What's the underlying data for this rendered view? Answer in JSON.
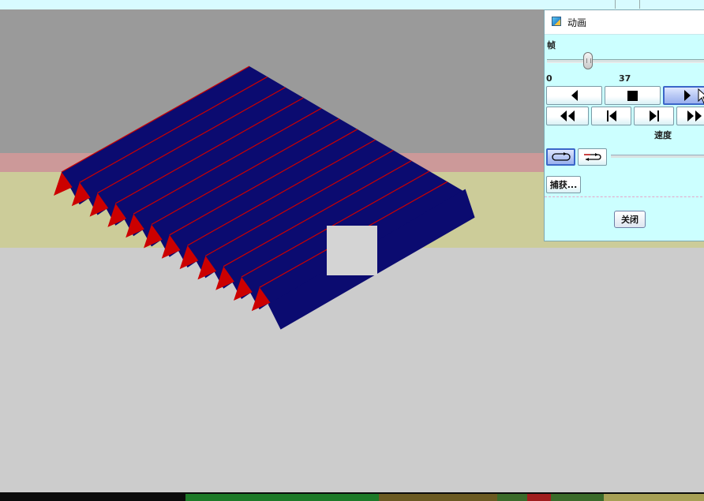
{
  "window": {
    "title": "动画"
  },
  "panel": {
    "frame_label": "帧",
    "slider_min_label": "0",
    "slider_value_label": "37",
    "slider_value": 37,
    "speed_label": "速度",
    "capture_label": "捕获...",
    "close_label": "关闭"
  },
  "controls": [
    {
      "id": "step-back",
      "icon": "triangle-left-icon"
    },
    {
      "id": "stop",
      "icon": "stop-square-icon"
    },
    {
      "id": "play",
      "icon": "triangle-right-icon",
      "active": true
    },
    {
      "id": "fast-back",
      "icon": "double-triangle-left-icon"
    },
    {
      "id": "to-start",
      "icon": "skip-to-start-icon"
    },
    {
      "id": "to-end",
      "icon": "skip-to-end-icon"
    },
    {
      "id": "fast-forward",
      "icon": "double-triangle-right-icon"
    },
    {
      "id": "loop",
      "icon": "loop-icon",
      "active": true
    },
    {
      "id": "bounce",
      "icon": "bounce-icon"
    }
  ],
  "scene": {
    "colors": {
      "sky_gray": "#9a9a9a",
      "pink_band": "#cc9999",
      "khaki_band": "#cccc99",
      "floor_gray": "#cccccc",
      "fin_face": "#0b0b70",
      "fin_edge_red": "#cc0000",
      "plane_light": "#d4d4d4"
    },
    "fin_count": 12
  },
  "accent_colors": {
    "panel_bg": "#ccffff",
    "active_button": "#3b66c9"
  }
}
